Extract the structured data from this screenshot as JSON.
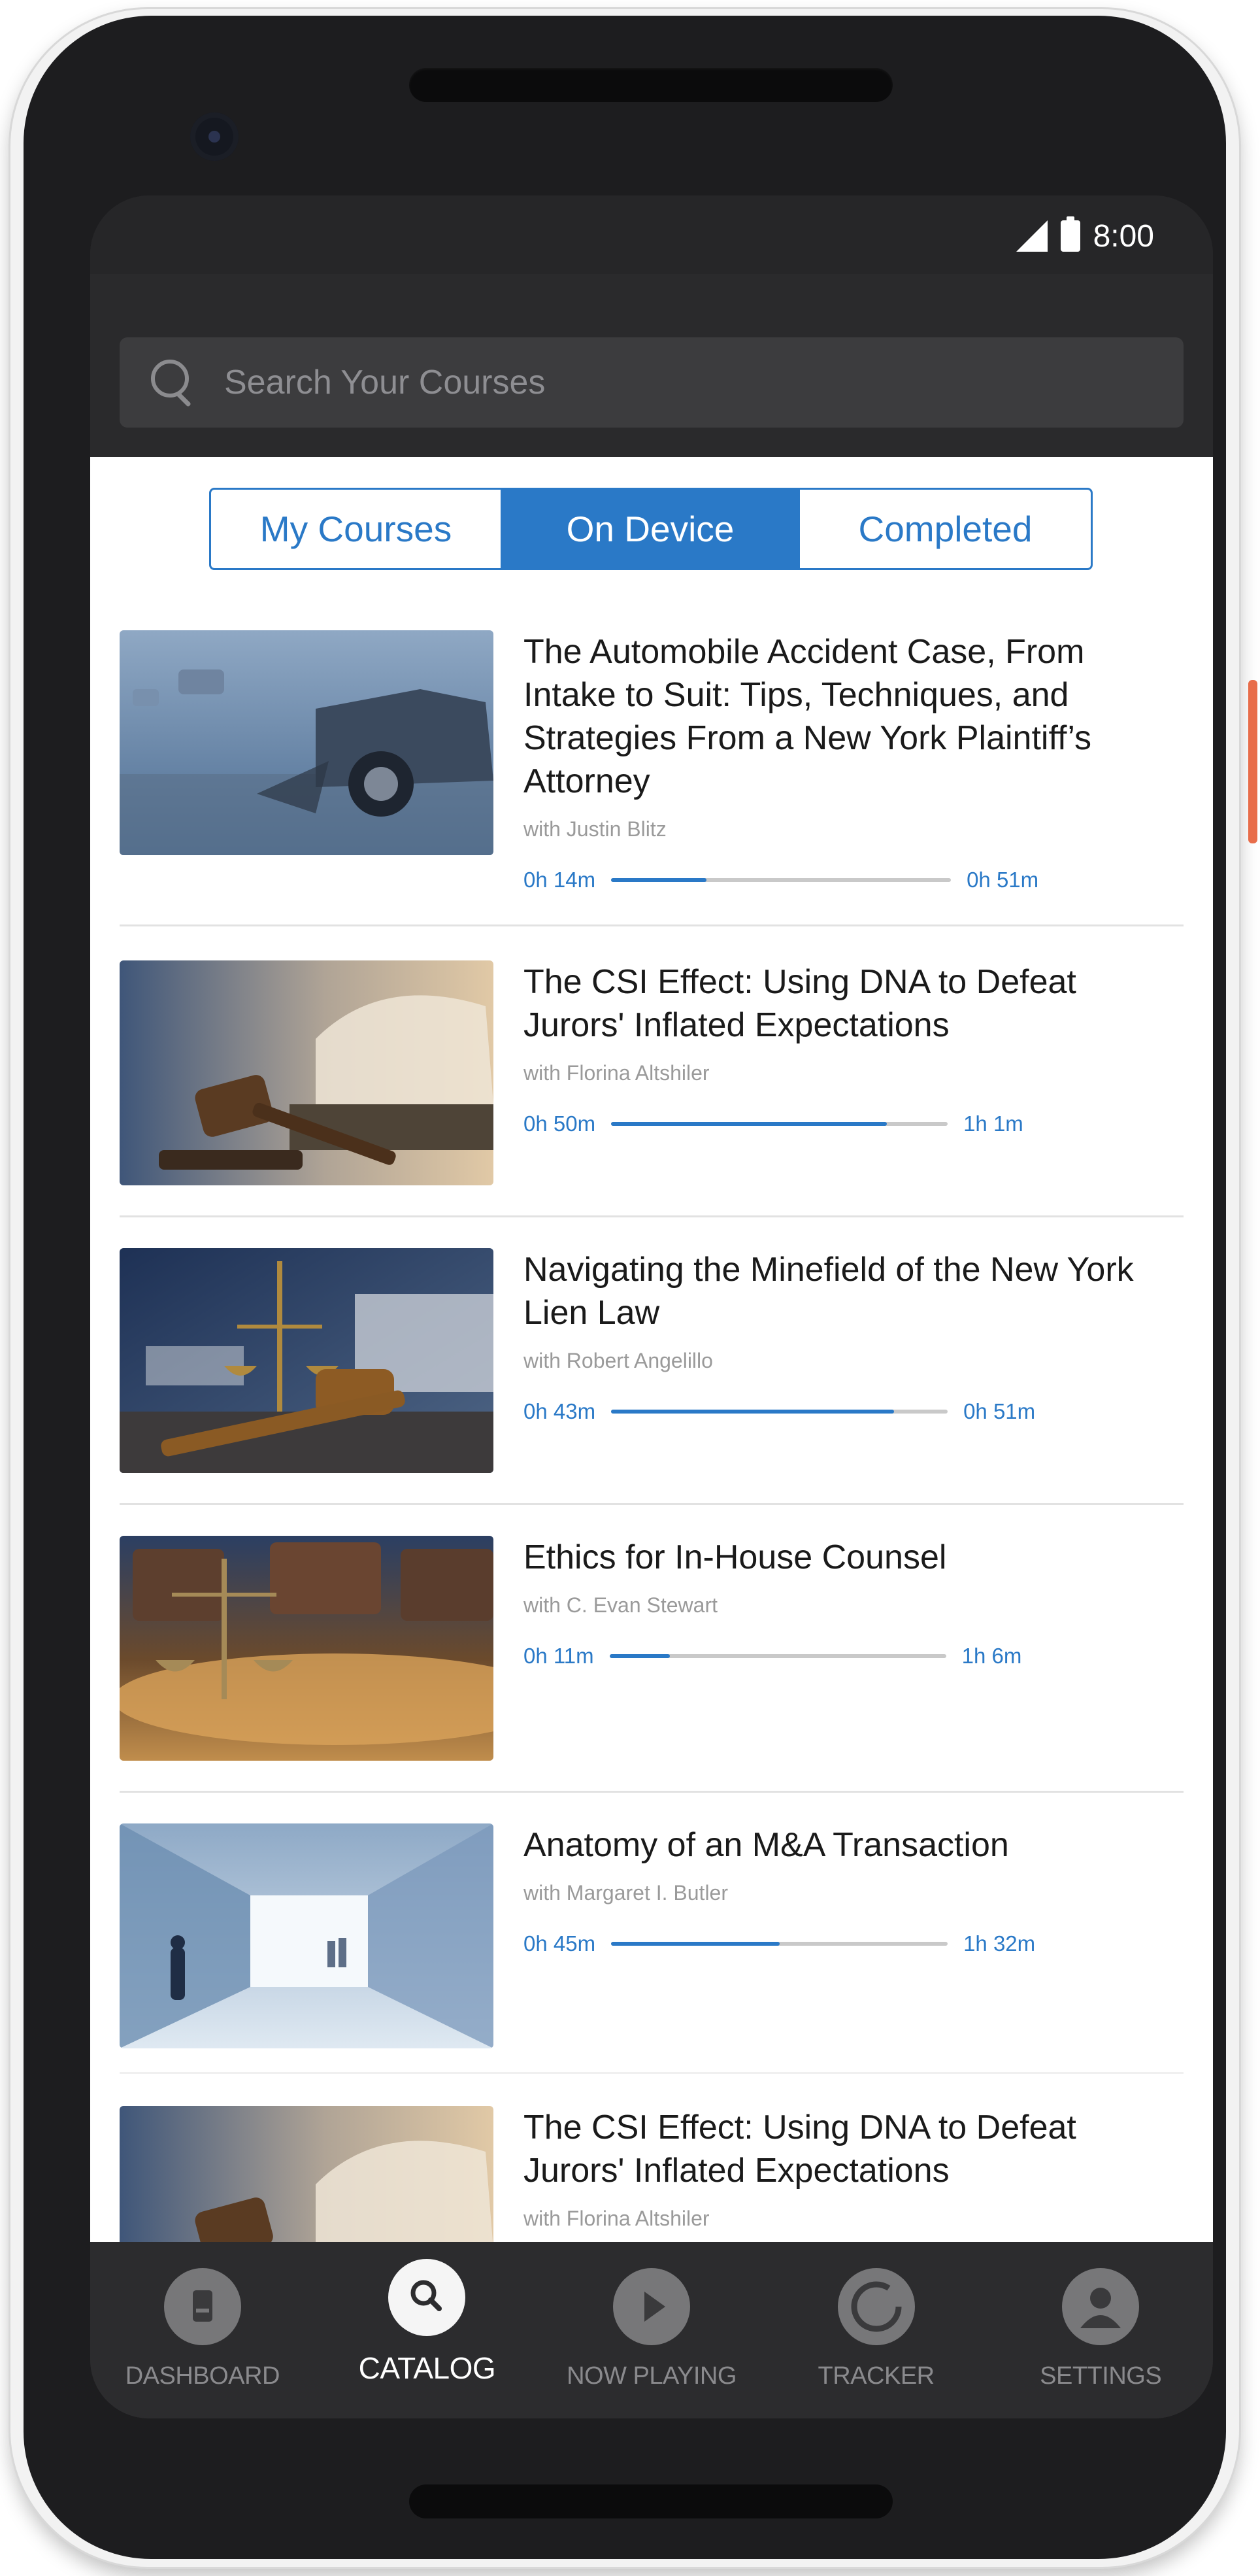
{
  "status_bar": {
    "time": "8:00"
  },
  "search": {
    "placeholder": "Search Your Courses"
  },
  "tabs": [
    {
      "label": "My Courses",
      "selected": false
    },
    {
      "label": "On Device",
      "selected": true
    },
    {
      "label": "Completed",
      "selected": false
    }
  ],
  "courses": [
    {
      "title": "The Automobile Accident Case, From Intake to Suit: Tips, Techniques, and Strategies From a New York Plaintiff’s Attorney",
      "author": "with Justin Blitz",
      "elapsed": "0h 14m",
      "total": "0h 51m",
      "progress": 0.28,
      "thumbnail": "car-crash"
    },
    {
      "title": "The CSI Effect: Using DNA to Defeat Jurors' Inflated Expectations",
      "author": "with Florina Altshiler",
      "elapsed": "0h 50m",
      "total": "1h 1m",
      "progress": 0.82,
      "thumbnail": "gavel-book"
    },
    {
      "title": "Navigating the Minefield of the New York Lien Law",
      "author": "with Robert Angelillo",
      "elapsed": "0h 43m",
      "total": "0h 51m",
      "progress": 0.84,
      "thumbnail": "scales-gavel"
    },
    {
      "title": "Ethics for In-House Counsel",
      "author": "with C. Evan Stewart",
      "elapsed": "0h 11m",
      "total": "1h 6m",
      "progress": 0.18,
      "thumbnail": "scales-desk"
    },
    {
      "title": "Anatomy of an M&A Transaction",
      "author": "with Margaret I. Butler",
      "elapsed": "0h 45m",
      "total": "1h 32m",
      "progress": 0.5,
      "thumbnail": "office-hallway"
    },
    {
      "title": "The CSI Effect: Using DNA to Defeat Jurors' Inflated Expectations",
      "author": "with Florina Altshiler",
      "elapsed": "",
      "total": "",
      "progress": null,
      "thumbnail": "gavel-book"
    }
  ],
  "nav": [
    {
      "label": "DASHBOARD",
      "icon": "dashboard-icon",
      "active": false
    },
    {
      "label": "CATALOG",
      "icon": "search-icon",
      "active": true
    },
    {
      "label": "NOW PLAYING",
      "icon": "play-icon",
      "active": false
    },
    {
      "label": "TRACKER",
      "icon": "tracker-icon",
      "active": false
    },
    {
      "label": "SETTINGS",
      "icon": "user-icon",
      "active": false
    }
  ],
  "colors": {
    "accent": "#2a79c7",
    "screen_dark": "#2a2a2c",
    "nav_bg": "#2c2c2e"
  }
}
